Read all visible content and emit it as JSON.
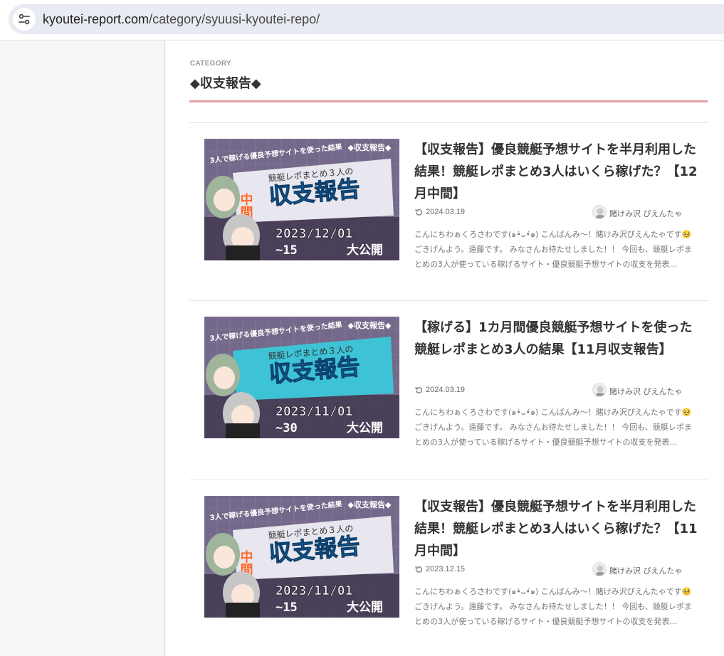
{
  "browser": {
    "url_domain": "kyoutei-report.com",
    "url_path": "/category/syuusi-kyoutei-repo/"
  },
  "category": {
    "label": "CATEGORY",
    "title": "◆収支報告◆"
  },
  "articles": [
    {
      "title": "【収支報告】優良競艇予想サイトを半月利用した結果！競艇レポまとめ3人はいくら稼げた？【12月中間】",
      "date": "2024.03.19",
      "author": "賭けみ沢 ぴえんたゃ",
      "excerpt": "こんにちわぁくろさわです(๑•̀ᴗ•́๑) こんばんみ〜！賭けみ沢ぴえんたゃです🥺 ごきげんよう。遠藤です。 みなさんお待たせしました！！ 今回も、競艇レポまとめの3人が使っている稼げるサイト・優良競艇予想サイトの収支を発表...",
      "thumb": {
        "tag": "◆収支報告◆",
        "top_text": "3人で稼げる優良予想サイトを使った結果",
        "sub_text": "競艇レポまとめ３人の",
        "side_text": "中間",
        "main_text": "収支報告",
        "date_text": "2023/12/01",
        "range_text": "~15",
        "release_text": "大公開",
        "accent": "#5b6b7a"
      }
    },
    {
      "title": "【稼げる】1カ月間優良競艇予想サイトを使った競艇レポまとめ3人の結果【11月収支報告】",
      "date": "2024.03.19",
      "author": "賭けみ沢 ぴえんたゃ",
      "excerpt": "こんにちわぁくろさわです(๑•̀ᴗ•́๑) こんばんみ〜！賭けみ沢ぴえんたゃです🥺 ごきげんよう。遠藤です。 みなさんお待たせしました！！ 今回も、競艇レポまとめの3人が使っている稼げるサイト・優良競艇予想サイトの収支を発表...",
      "thumb": {
        "tag": "◆収支報告◆",
        "top_text": "3人で稼げる優良予想サイトを使った結果",
        "sub_text": "競艇レポまとめ３人の",
        "side_text": "",
        "main_text": "収支報告",
        "date_text": "2023/11/01",
        "range_text": "~30",
        "release_text": "大公開",
        "accent": "#3ec3d6"
      }
    },
    {
      "title": "【収支報告】優良競艇予想サイトを半月利用した結果！競艇レポまとめ3人はいくら稼げた？【11月中間】",
      "date": "2023.12.15",
      "author": "賭けみ沢 ぴえんたゃ",
      "excerpt": "こんにちわぁくろさわです(๑•̀ᴗ•́๑) こんばんみ〜！賭けみ沢ぴえんたゃです🥺 ごきげんよう。遠藤です。 みなさんお待たせしました！！ 今回も、競艇レポまとめの3人が使っている稼げるサイト・優良競艇予想サイトの収支を発表...",
      "thumb": {
        "tag": "◆収支報告◆",
        "top_text": "3人で稼げる優良予想サイトを使った結果",
        "sub_text": "競艇レポまとめ３人の",
        "side_text": "中間",
        "main_text": "収支報告",
        "date_text": "2023/11/01",
        "range_text": "~15",
        "release_text": "大公開",
        "accent": "#5b6b7a"
      }
    }
  ]
}
